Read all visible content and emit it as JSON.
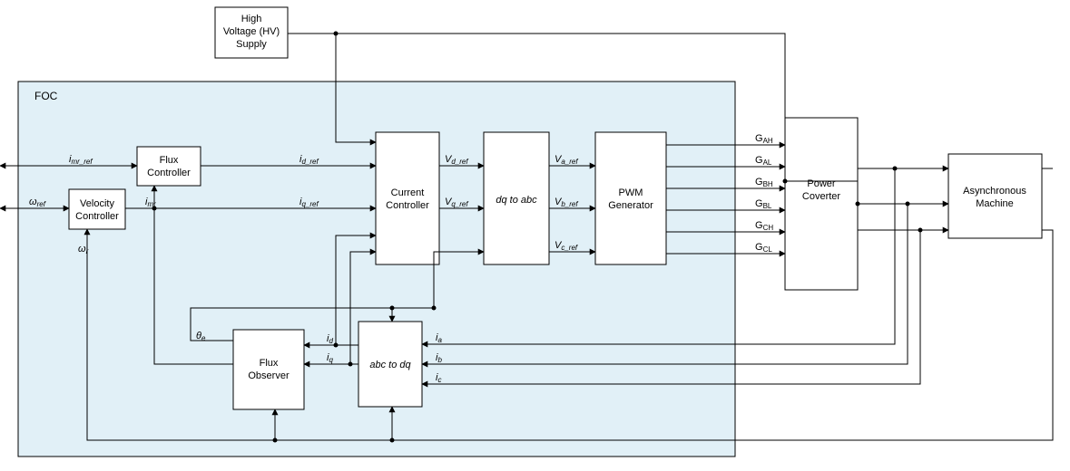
{
  "foc_label": "FOC",
  "blocks": {
    "hv": {
      "l1": "High",
      "l2": "Voltage (HV)",
      "l3": "Supply"
    },
    "flux_ctrl": {
      "l1": "Flux",
      "l2": "Controller"
    },
    "vel_ctrl": {
      "l1": "Velocity",
      "l2": "Controller"
    },
    "cur_ctrl": {
      "l1": "Current",
      "l2": "Controller"
    },
    "dq_abc": "dq to abc",
    "pwm": {
      "l1": "PWM",
      "l2": "Generator"
    },
    "power": {
      "l1": "Power",
      "l2": "Coverter"
    },
    "async": {
      "l1": "Asynchronous",
      "l2": "Machine"
    },
    "flux_obs": {
      "l1": "Flux",
      "l2": "Observer"
    },
    "abc_dq": "abc to dq"
  },
  "signals": {
    "imr_ref": "i_mr_ref",
    "w_ref": "ω_ref",
    "imr": "i_mr",
    "wr": "ω_r",
    "id_ref": "i_d_ref",
    "iq_ref": "i_q_ref",
    "vd_ref": "V_d_ref",
    "vq_ref": "V_q_ref",
    "va_ref": "V_a_ref",
    "vb_ref": "V_b_ref",
    "vc_ref": "V_c_ref",
    "gah": "G_AH",
    "gal": "G_AL",
    "gbh": "G_BH",
    "gbl": "G_BL",
    "gch": "G_CH",
    "gcl": "G_CL",
    "theta": "θ_e",
    "id": "i_d",
    "iq": "i_q",
    "ia": "i_a",
    "ib": "i_b",
    "ic": "i_c"
  }
}
